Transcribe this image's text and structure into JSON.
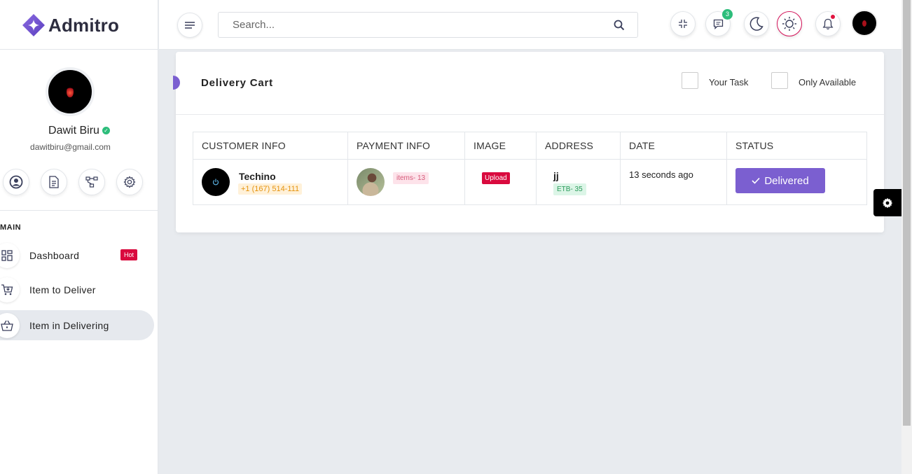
{
  "app": {
    "name": "Admitro"
  },
  "profile": {
    "name": "Dawit Biru",
    "email": "dawitbiru@gmail.com"
  },
  "sidebar": {
    "section_title": "MAIN",
    "quick_icons": [
      "user-icon",
      "document-icon",
      "sitemap-icon",
      "settings-icon"
    ],
    "items": [
      {
        "label": "Dashboard",
        "icon": "dashboard-icon",
        "badge": "Hot"
      },
      {
        "label": "Item to Deliver",
        "icon": "cart-icon"
      },
      {
        "label": "Item in Delivering",
        "icon": "basket-icon",
        "active": true
      }
    ]
  },
  "header": {
    "search_placeholder": "Search...",
    "message_count": "3"
  },
  "card": {
    "title": "Delivery Cart",
    "filters": [
      {
        "label": "Your Task",
        "checked": false
      },
      {
        "label": "Only Available",
        "checked": false
      }
    ]
  },
  "table": {
    "headers": [
      "CUSTOMER INFO",
      "PAYMENT INFO",
      "IMAGE",
      "ADDRESS",
      "DATE",
      "STATUS"
    ],
    "rows": [
      {
        "customer_name": "Techino",
        "customer_phone": "+1 (167) 514-111",
        "items": "items- 13",
        "image": "Upload",
        "address_name": "jj",
        "address_code": "ETB- 35",
        "date": "13 seconds ago",
        "status": "Delivered"
      }
    ]
  },
  "colors": {
    "accent": "#7b5fd0",
    "danger": "#d90a3e",
    "success": "#2dbd7b"
  }
}
